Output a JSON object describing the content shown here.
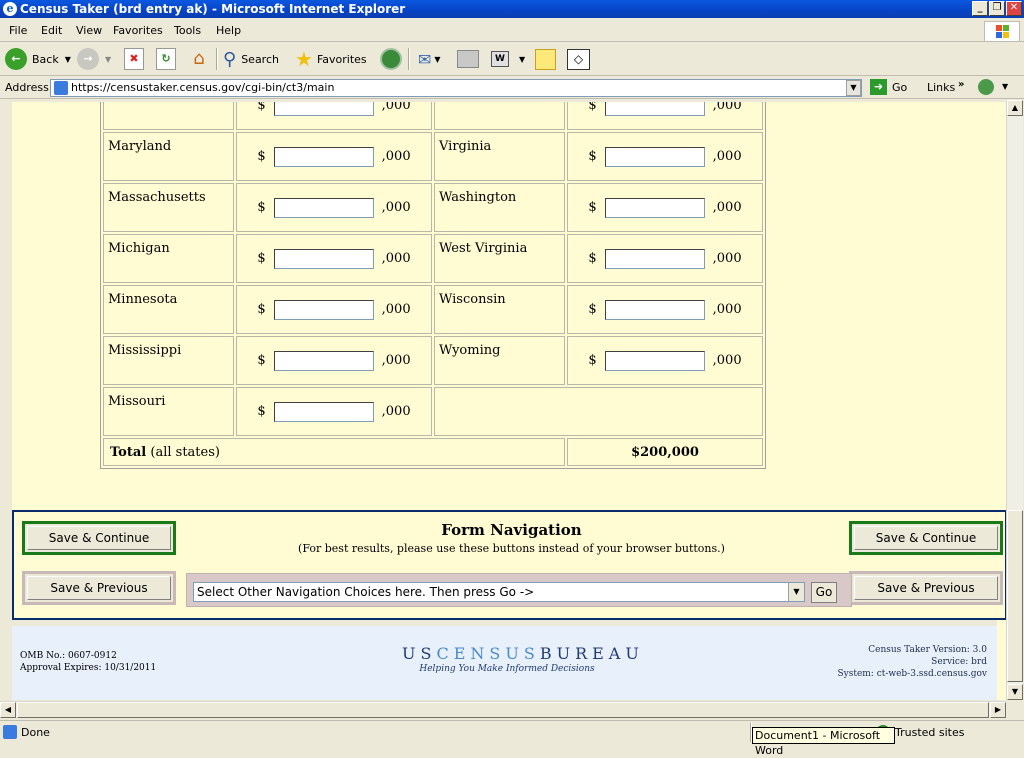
{
  "window": {
    "title": "Census Taker (brd entry ak) - Microsoft Internet Explorer"
  },
  "menu": [
    "File",
    "Edit",
    "View",
    "Favorites",
    "Tools",
    "Help"
  ],
  "toolbar": {
    "back": "Back",
    "search": "Search",
    "favorites": "Favorites"
  },
  "address": {
    "label": "Address",
    "url": "https://censustaker.census.gov/cgi-bin/ct3/main",
    "go": "Go",
    "links": "Links"
  },
  "form": {
    "currency_prefix": "$",
    "suffix": ",000",
    "rows": [
      {
        "left": "Maryland",
        "right": "Virginia"
      },
      {
        "left": "Massachusetts",
        "right": "Washington"
      },
      {
        "left": "Michigan",
        "right": "West Virginia"
      },
      {
        "left": "Minnesota",
        "right": "Wisconsin"
      },
      {
        "left": "Mississippi",
        "right": "Wyoming"
      },
      {
        "left": "Missouri",
        "right": ""
      }
    ],
    "total_label_bold": "Total",
    "total_label_rest": "(all states)",
    "total_value": "$200,000"
  },
  "nav": {
    "title": "Form Navigation",
    "subtitle": "(For best results, please use these buttons instead of your browser buttons.)",
    "save_continue": "Save & Continue",
    "save_previous": "Save & Previous",
    "select_value": "Select Other Navigation Choices here. Then press Go ->",
    "go": "Go"
  },
  "footer": {
    "omb": "OMB No.: 0607-0912",
    "approval": "Approval Expires: 10/31/2011",
    "logo_word": "USCENSUSBUREAU",
    "tagline": "Helping You Make Informed Decisions",
    "version": "Census Taker Version: 3.0",
    "service": "Service: brd",
    "system": "System: ct-web-3.ssd.census.gov"
  },
  "status": {
    "left": "Done",
    "zone": "Trusted sites",
    "taskbar_popup": "Document1 - Microsoft Word"
  }
}
